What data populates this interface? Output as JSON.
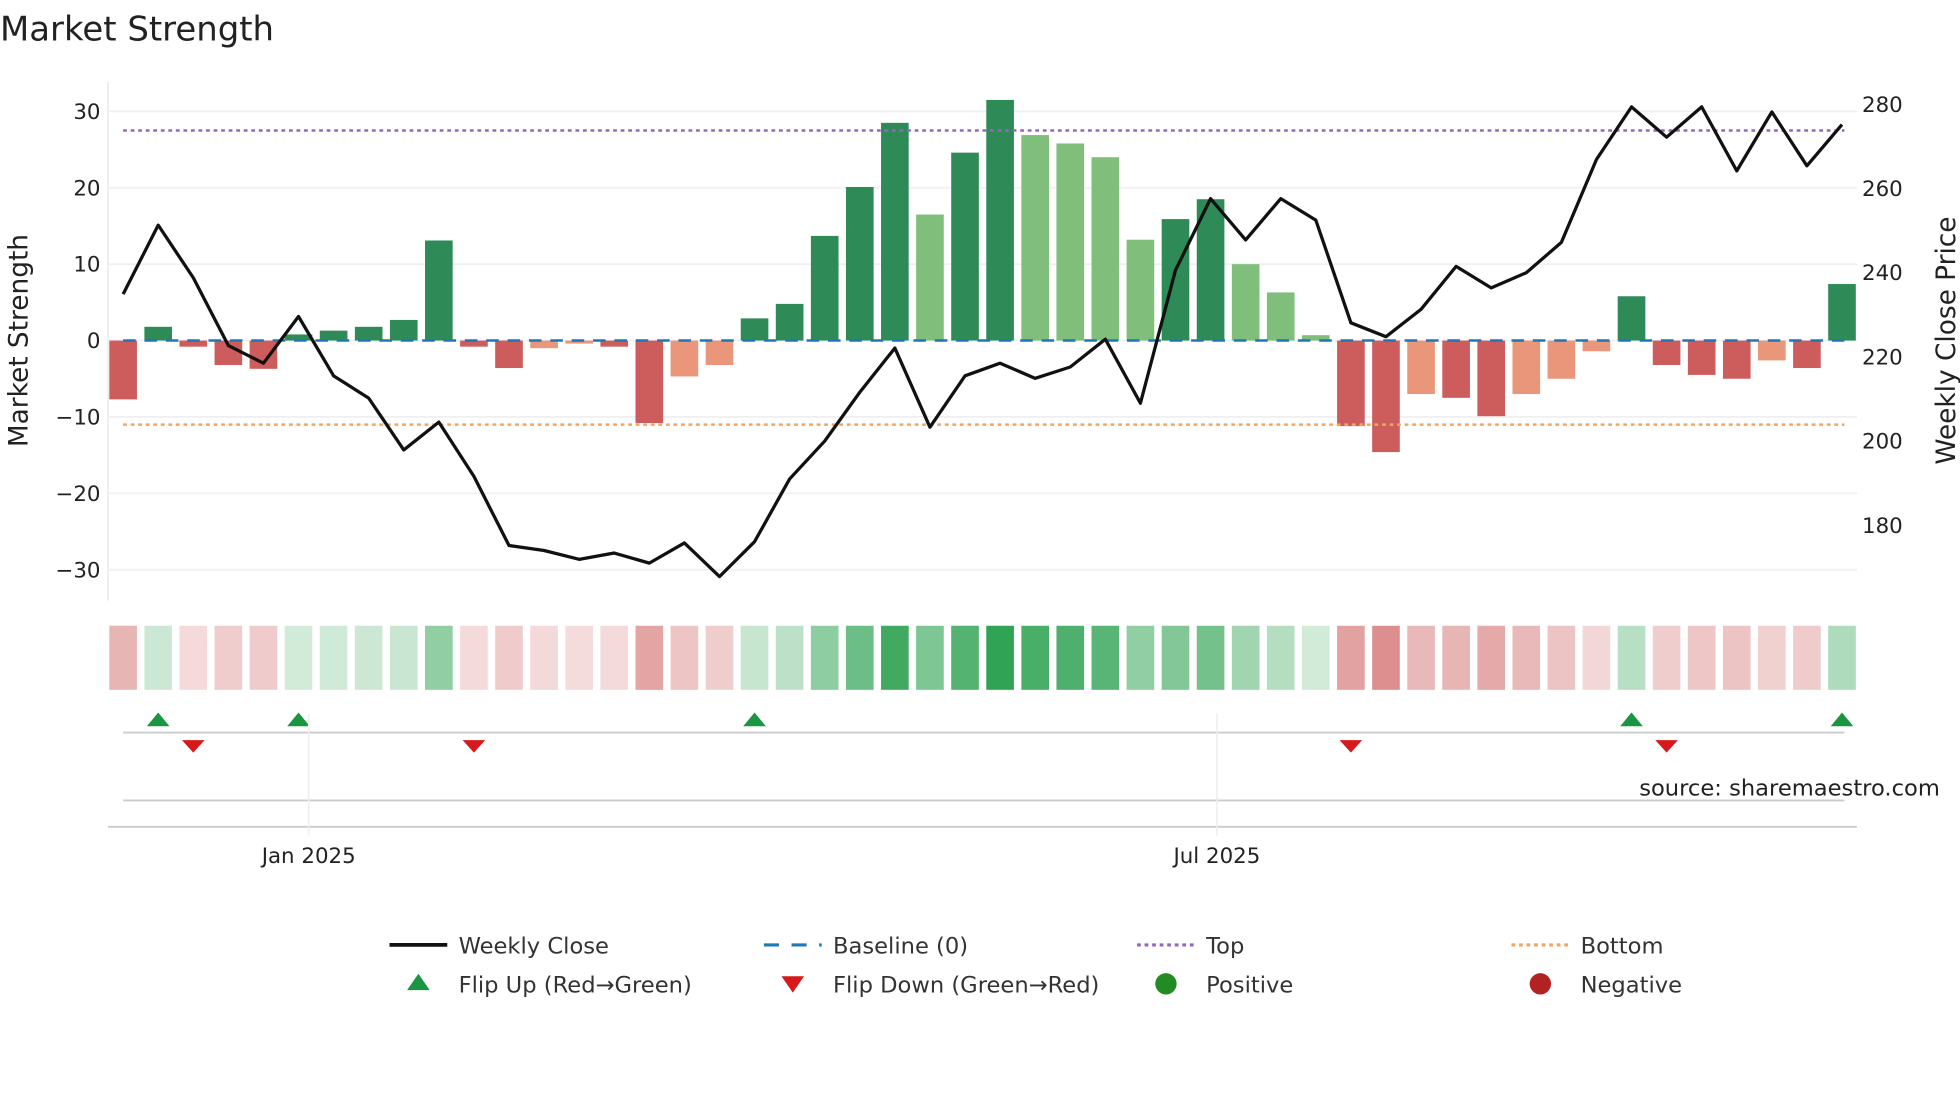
{
  "chart_data": {
    "type": "bar",
    "title": "Market Strength",
    "ylabel": "Market Strength",
    "y2label": "Weekly Close Price",
    "ylim": [
      -34,
      34
    ],
    "y2lim": [
      166,
      284
    ],
    "yticks": [
      30,
      20,
      10,
      0,
      -10,
      -20,
      -30
    ],
    "ytick_labels": [
      "30",
      "20",
      "10",
      "0",
      "−10",
      "−20",
      "−30"
    ],
    "y2ticks": [
      280,
      260,
      240,
      220,
      200,
      180
    ],
    "xticks": [
      {
        "label": "Jan 2025",
        "week_index": 5.29
      },
      {
        "label": "Jul 2025",
        "week_index": 31.18
      }
    ],
    "top_level": 27.5,
    "bottom_level": -11,
    "baseline": 0,
    "strength": [
      -7.7,
      1.8,
      -0.8,
      -3.2,
      -3.7,
      0.8,
      1.3,
      1.8,
      2.7,
      13.1,
      -0.8,
      -3.6,
      -1.0,
      -0.4,
      -0.8,
      -10.8,
      -4.7,
      -3.2,
      2.9,
      4.8,
      13.7,
      20.1,
      28.5,
      16.5,
      24.6,
      31.5,
      26.9,
      25.8,
      24.0,
      13.2,
      15.9,
      18.5,
      10.0,
      6.3,
      0.7,
      -11.2,
      -14.6,
      -7.0,
      -7.5,
      -9.9,
      -7.0,
      -5.0,
      -1.4,
      5.8,
      -3.2,
      -4.5,
      -5.0,
      -2.6,
      -3.6,
      7.4
    ],
    "light_shade": [
      13,
      14,
      17,
      18,
      24,
      27,
      28,
      29,
      30,
      33,
      34,
      35,
      38,
      41,
      42,
      43,
      48
    ],
    "weekly_close": [
      234.6,
      251.0,
      238.5,
      222.4,
      218.2,
      229.3,
      215.2,
      209.9,
      197.6,
      204.2,
      191.3,
      174.9,
      173.7,
      171.6,
      173.1,
      170.7,
      175.5,
      167.5,
      175.8,
      190.7,
      199.7,
      211.3,
      221.8,
      203.0,
      215.2,
      218.2,
      214.6,
      217.3,
      223.9,
      208.7,
      240.3,
      257.3,
      247.5,
      257.3,
      252.2,
      227.8,
      224.5,
      231.0,
      241.2,
      236.1,
      239.7,
      246.9,
      266.6,
      279.1,
      271.9,
      279.1,
      263.9,
      277.9,
      265.1,
      274.9
    ],
    "flip_up_weeks": [
      2,
      6,
      19,
      44,
      50
    ],
    "flip_down_weeks": [
      3,
      11,
      36,
      45
    ],
    "legend": [
      {
        "label": "Weekly Close",
        "marker": "line-solid"
      },
      {
        "label": "Baseline (0)",
        "marker": "line-dashed"
      },
      {
        "label": "Top",
        "marker": "line-dotted"
      },
      {
        "label": "Bottom",
        "marker": "line-dotted"
      },
      {
        "label": "Flip Up (Red→Green)",
        "marker": "triangle-up"
      },
      {
        "label": "Flip Down (Green→Red)",
        "marker": "triangle-down"
      },
      {
        "label": "Positive",
        "marker": "circle"
      },
      {
        "label": "Negative",
        "marker": "circle"
      }
    ],
    "source": "source: sharemaestro.com",
    "colors": {
      "pos_dark": "#2e8b57",
      "pos_light": "#7fbf7b",
      "neg_dark": "#cd5c5c",
      "neg_light": "#e9967a",
      "line": "#111111",
      "baseline": "#1f77b4",
      "top": "#9467bd",
      "bottom": "#f4a460",
      "flip_up": "#1a9641",
      "flip_down": "#d7191c",
      "positive": "#228b22",
      "negative": "#b22222"
    }
  }
}
